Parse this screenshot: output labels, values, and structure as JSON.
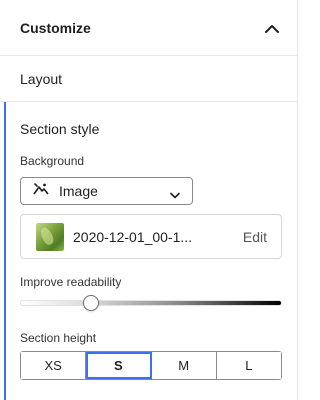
{
  "header": {
    "title": "Customize",
    "collapse_icon": "chevron-up-icon"
  },
  "layout": {
    "label": "Layout"
  },
  "section_style": {
    "title": "Section style",
    "background": {
      "label": "Background",
      "dropdown_value": "Image",
      "dropdown_icon": "image-icon",
      "chevron_icon": "chevron-down-icon"
    },
    "image": {
      "filename": "2020-12-01_00-1...",
      "edit_label": "Edit"
    },
    "readability": {
      "label": "Improve readability",
      "value": 0.27
    },
    "height": {
      "label": "Section height",
      "options": [
        "XS",
        "S",
        "M",
        "L"
      ],
      "selected": "S"
    }
  },
  "colors": {
    "accent": "#3b6ff5"
  }
}
